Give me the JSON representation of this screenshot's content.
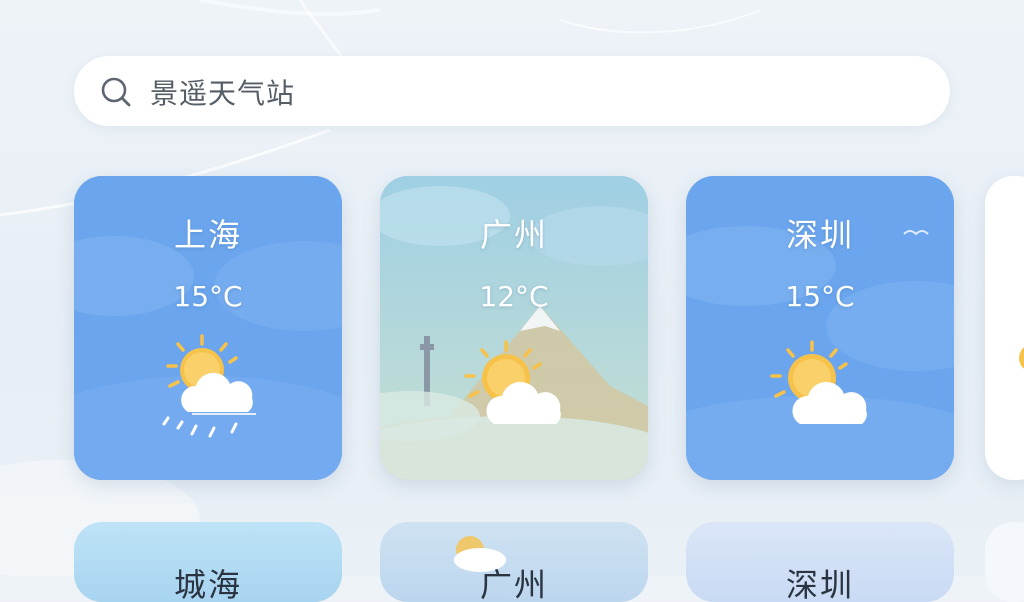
{
  "search": {
    "text": "景遥天气站"
  },
  "cards": [
    {
      "city": "上海",
      "temp": "15°C",
      "icon": "sun-cloud-rain-icon",
      "bg": "#6ea8ef"
    },
    {
      "city": "广州",
      "temp": "12°C",
      "icon": "sun-cloud-icon",
      "bg": "#a9d2e0"
    },
    {
      "city": "深圳",
      "temp": "15°C",
      "icon": "sun-cloud-icon",
      "bg": "#6ea8ef"
    }
  ],
  "bottom_cards": [
    {
      "city": "城海"
    },
    {
      "city": "广州"
    },
    {
      "city": "深圳"
    }
  ],
  "colors": {
    "background": "#e9f0f6",
    "card_blue": "#6ea8ef",
    "card_teal": "#a9d2e0",
    "sun": "#f7c24a",
    "cloud": "#ffffff"
  }
}
